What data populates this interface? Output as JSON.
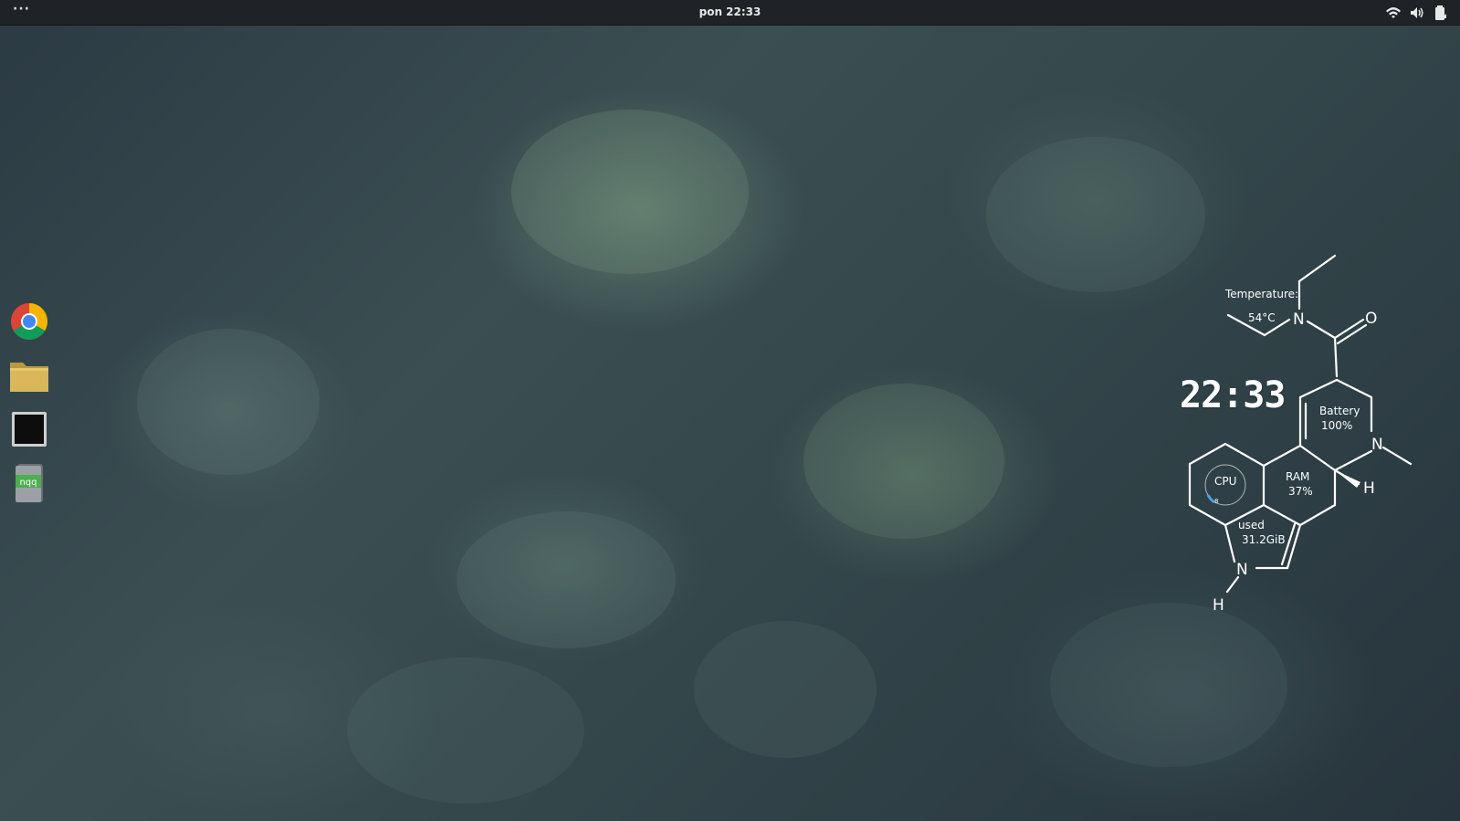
{
  "topbar": {
    "activities_label": "···",
    "clock": "pon 22:33",
    "tray_icons": [
      "wifi-icon",
      "volume-icon",
      "battery-icon"
    ]
  },
  "dock": {
    "items": [
      {
        "icon": "chrome-icon"
      },
      {
        "icon": "folder-icon"
      },
      {
        "icon": "terminal-icon"
      },
      {
        "icon": "android-studio-icon",
        "label": "nqq"
      }
    ]
  },
  "widget": {
    "temperature_label": "Temperature:",
    "temperature_value": "54°C",
    "time": "22:33",
    "battery_label": "Battery",
    "battery_value": "100%",
    "cpu_label": "CPU",
    "cpu_value": "8",
    "ram_label": "RAM",
    "ram_value": "37%",
    "used_label": "used",
    "used_value": "31.2GiB",
    "atoms": {
      "n_top": "N",
      "o": "O",
      "n_right": "N",
      "h_right": "H",
      "n_bottom": "N",
      "h_bottom": "H"
    }
  },
  "colors": {
    "topbar_bg": "#1f2327",
    "widget_stroke": "#ffffff",
    "cpu_ring": "#4aa3df"
  }
}
